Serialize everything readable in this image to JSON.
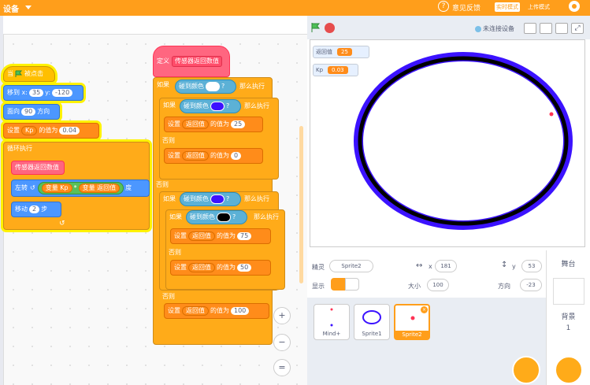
{
  "topbar": {
    "title": "设备",
    "feedback": "意见反馈",
    "realtime": "实时模式",
    "upload": "上传模式"
  },
  "stagebar": {
    "connection": "未连接设备"
  },
  "script1": {
    "hat": "当",
    "hat_suffix": "被点击",
    "goto": {
      "label": "移到 x:",
      "x": "35",
      "ylabel": "y:",
      "y": "-120"
    },
    "dir": {
      "label": "面向",
      "val": "90",
      "suffix": "方向"
    },
    "setkp": {
      "label": "设置",
      "var": "Kp",
      "mid": "的值为",
      "val": "0.04"
    },
    "loop": "循环执行",
    "call": "传感器返回数值",
    "turn": {
      "label": "左转",
      "a": "变量 Kp",
      "op": "*",
      "b": "变量 返回值",
      "suffix": "度"
    },
    "move": {
      "label": "移动",
      "val": "2",
      "suffix": "步"
    }
  },
  "script2": {
    "define": "定义",
    "proc": "传感器返回数值",
    "if1": {
      "pre": "如果",
      "cond": "碰到颜色",
      "q": "?",
      "post": "那么执行"
    },
    "if2": {
      "pre": "如果",
      "cond": "碰到颜色",
      "q": "?",
      "post": "那么执行"
    },
    "set25": {
      "label": "设置",
      "var": "返回值",
      "mid": "的值为",
      "val": "25"
    },
    "else1": "否则",
    "set0": {
      "label": "设置",
      "var": "返回值",
      "mid": "的值为",
      "val": "0"
    },
    "else2": "否则",
    "if3": {
      "pre": "如果",
      "cond": "碰到颜色",
      "q": "?",
      "post": "那么执行"
    },
    "if4": {
      "pre": "如果",
      "cond": "碰到颜色",
      "q": "?",
      "post": "那么执行"
    },
    "set75": {
      "label": "设置",
      "var": "返回值",
      "mid": "的值为",
      "val": "75"
    },
    "else3": "否则",
    "set50": {
      "label": "设置",
      "var": "返回值",
      "mid": "的值为",
      "val": "50"
    },
    "else4": "否则",
    "set100": {
      "label": "设置",
      "var": "返回值",
      "mid": "的值为",
      "val": "100"
    }
  },
  "colors": {
    "white": "#ffffff",
    "blue": "#3b12ff",
    "black": "#000000"
  },
  "monitors": [
    {
      "name": "返回值",
      "value": "25"
    },
    {
      "name": "Kp",
      "value": "0.03"
    }
  ],
  "sprite_info": {
    "sprite_label": "精灵",
    "sprite_name": "Sprite2",
    "x": "181",
    "y_label": "y",
    "y": "53",
    "show_label": "显示",
    "size_label": "大小",
    "size": "100",
    "dir_label": "方向",
    "dir": "-23"
  },
  "sprites": [
    {
      "name": "Mind+"
    },
    {
      "name": "Sprite1"
    },
    {
      "name": "Sprite2"
    }
  ],
  "side": {
    "stage": "舞台",
    "backdrop": "背景",
    "count": "1"
  },
  "zoom": {
    "reset": "="
  }
}
